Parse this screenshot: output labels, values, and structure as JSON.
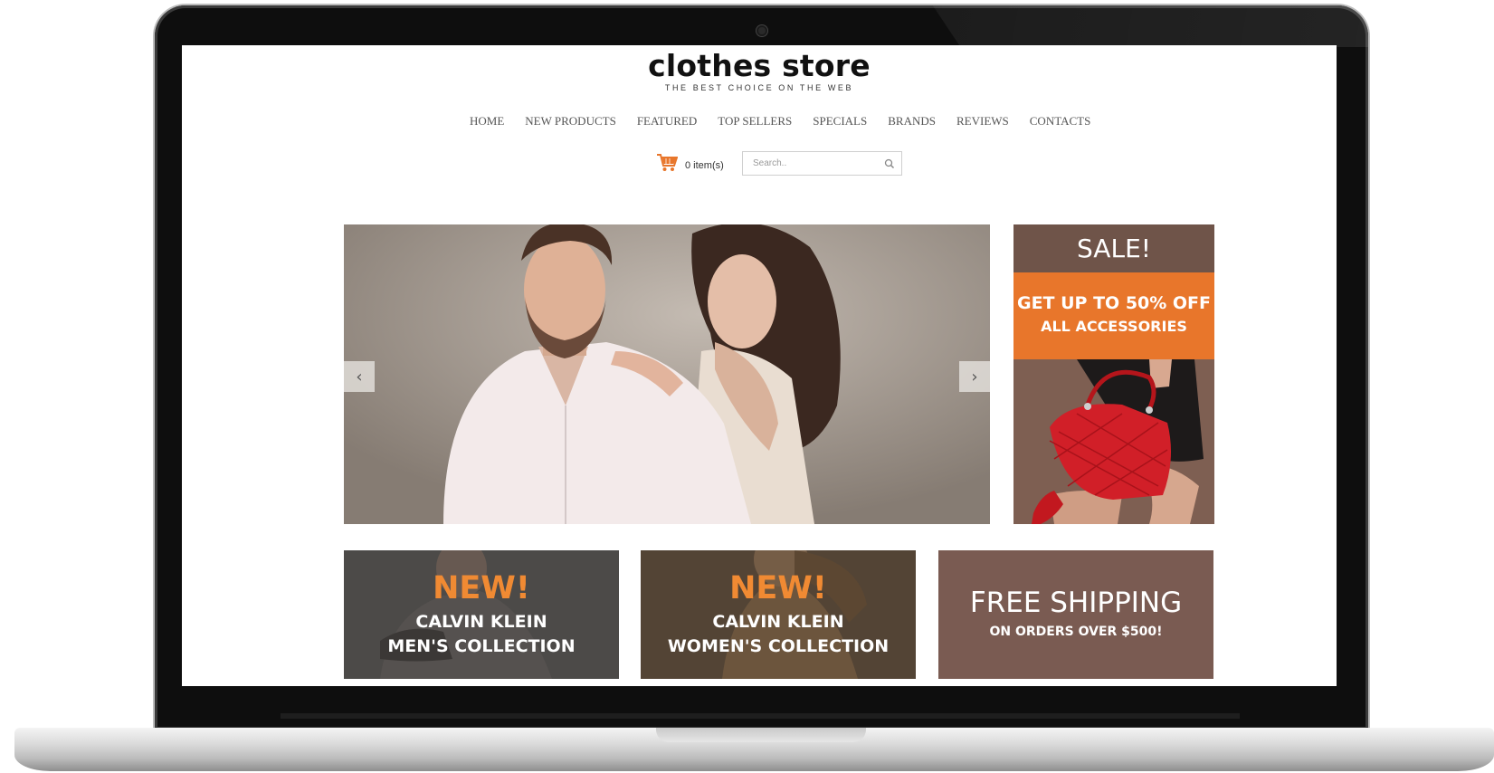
{
  "store": {
    "name": "clothes store",
    "tagline": "THE BEST CHOICE ON THE WEB"
  },
  "nav": {
    "items": [
      "HOME",
      "NEW PRODUCTS",
      "FEATURED",
      "TOP SELLERS",
      "SPECIALS",
      "BRANDS",
      "REVIEWS",
      "CONTACTS"
    ]
  },
  "cart": {
    "count_label": "0 item(s)",
    "icon": "shopping-cart-icon",
    "icon_color": "#e8762b"
  },
  "search": {
    "placeholder": "Search..",
    "icon": "search-icon"
  },
  "slider": {
    "prev_icon": "chevron-left-icon",
    "next_icon": "chevron-right-icon"
  },
  "sale": {
    "title": "SALE!",
    "offer_line1": "GET UP TO 50% OFF",
    "offer_line2": "ALL ACCESSORIES",
    "header_color": "#6f5449",
    "offer_color": "#e8762b"
  },
  "banners": [
    {
      "badge": "NEW!",
      "line1": "CALVIN KLEIN",
      "line2": "MEN'S COLLECTION"
    },
    {
      "badge": "NEW!",
      "line1": "CALVIN KLEIN",
      "line2": "WOMEN'S COLLECTION"
    }
  ],
  "shipping": {
    "title": "FREE SHIPPING",
    "subtitle": "ON ORDERS OVER $500!"
  },
  "colors": {
    "accent_orange": "#f08a33",
    "brown": "#7a5b52"
  }
}
